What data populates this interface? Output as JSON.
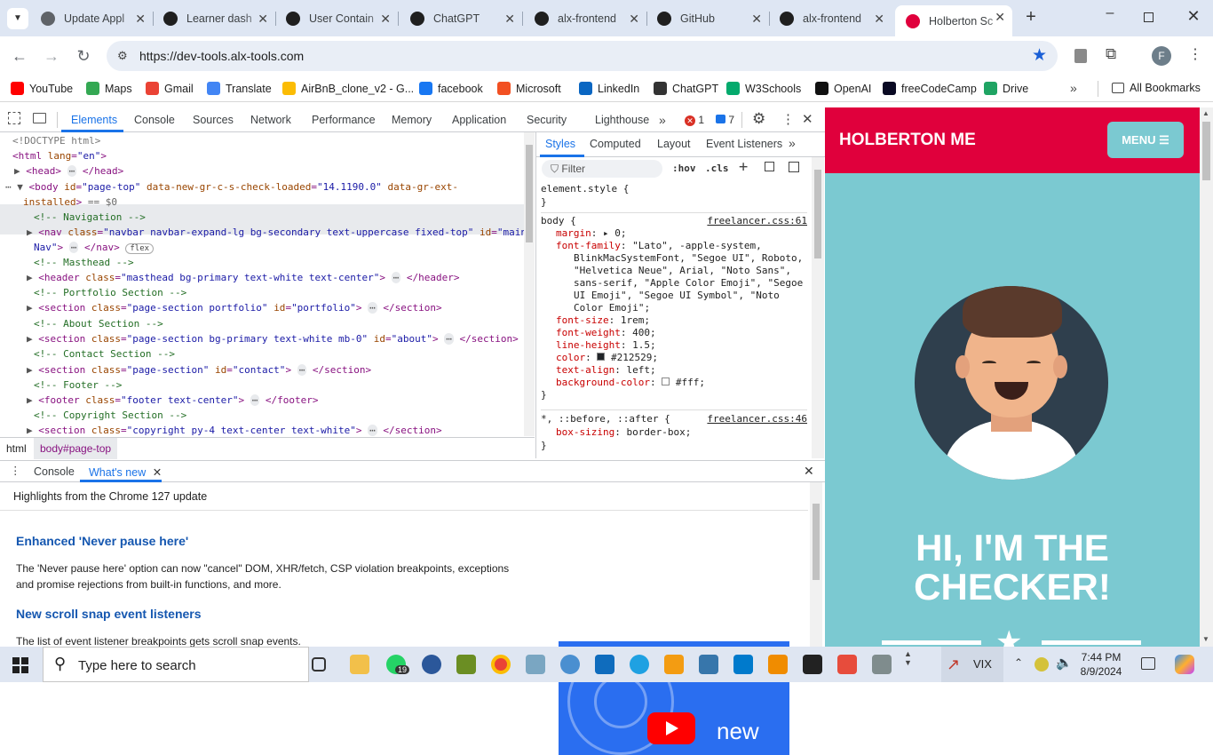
{
  "tabs": [
    {
      "title": "Update Appl",
      "icon": "globe-icon",
      "color": "#5f6368"
    },
    {
      "title": "Learner dash",
      "icon": "alx-icon",
      "color": "#1f1f1f"
    },
    {
      "title": "User Contain",
      "icon": "alx-icon",
      "color": "#1f1f1f"
    },
    {
      "title": "ChatGPT",
      "icon": "openai-icon",
      "color": "#1f1f1f"
    },
    {
      "title": "alx-frontend",
      "icon": "github-icon",
      "color": "#1f1f1f"
    },
    {
      "title": "GitHub",
      "icon": "github-icon",
      "color": "#1f1f1f"
    },
    {
      "title": "alx-frontend",
      "icon": "github-icon",
      "color": "#1f1f1f"
    },
    {
      "title": "Holberton Sc",
      "icon": "holberton-icon",
      "color": "#e0003c"
    }
  ],
  "address": {
    "url": "https://dev-tools.alx-tools.com",
    "profile_initial": "F"
  },
  "bookmarks": [
    {
      "label": "YouTube",
      "color": "#ff0000"
    },
    {
      "label": "Maps",
      "color": "#34a853"
    },
    {
      "label": "Gmail",
      "color": "#ea4335"
    },
    {
      "label": "Translate",
      "color": "#4285f4"
    },
    {
      "label": "AirBnB_clone_v2 - G...",
      "color": "#fbbc04"
    },
    {
      "label": "facebook",
      "color": "#1877f2"
    },
    {
      "label": "Microsoft",
      "color": "#f25022"
    },
    {
      "label": "LinkedIn",
      "color": "#0a66c2"
    },
    {
      "label": "ChatGPT",
      "color": "#333333"
    },
    {
      "label": "W3Schools",
      "color": "#04aa6d"
    },
    {
      "label": "OpenAI",
      "color": "#111111"
    },
    {
      "label": "freeCodeCamp",
      "color": "#0a0a23"
    },
    {
      "label": "Drive",
      "color": "#1fa463"
    }
  ],
  "all_bookmarks": "All Bookmarks",
  "devtools": {
    "tabs": [
      "Elements",
      "Console",
      "Sources",
      "Network",
      "Performance",
      "Memory",
      "Application",
      "Security",
      "Lighthouse"
    ],
    "error_count": "1",
    "message_count": "7",
    "crumbs": [
      "html",
      "body#page-top"
    ],
    "styles_tabs": [
      "Styles",
      "Computed",
      "Layout",
      "Event Listeners"
    ],
    "filter_placeholder": "Filter",
    "hov": ":hov",
    "cls": ".cls",
    "drawer_tabs": [
      "Console",
      "What's new"
    ],
    "whatsnew": {
      "highlights": "Highlights from the Chrome 127 update",
      "h1": "Enhanced 'Never pause here'",
      "p1": "The 'Never pause here' option can now \"cancel\" DOM, XHR/fetch, CSP violation breakpoints, exceptions and promise rejections from built-in functions, and more.",
      "h2": "New scroll snap event listeners",
      "p2": "The list of event listener breakpoints gets scroll snap events.",
      "video_label": "new"
    }
  },
  "page": {
    "brand": "HOLBERTON ME",
    "menu": "MENU",
    "heading_line1": "HI, I'M THE",
    "heading_line2": "CHECKER!",
    "primary": "#e0003c",
    "bg": "#7bc9d1"
  },
  "taskbar": {
    "search": "Type here to search",
    "time": "7:44 PM",
    "date": "8/9/2024",
    "vix": "VIX",
    "badge": "19"
  }
}
